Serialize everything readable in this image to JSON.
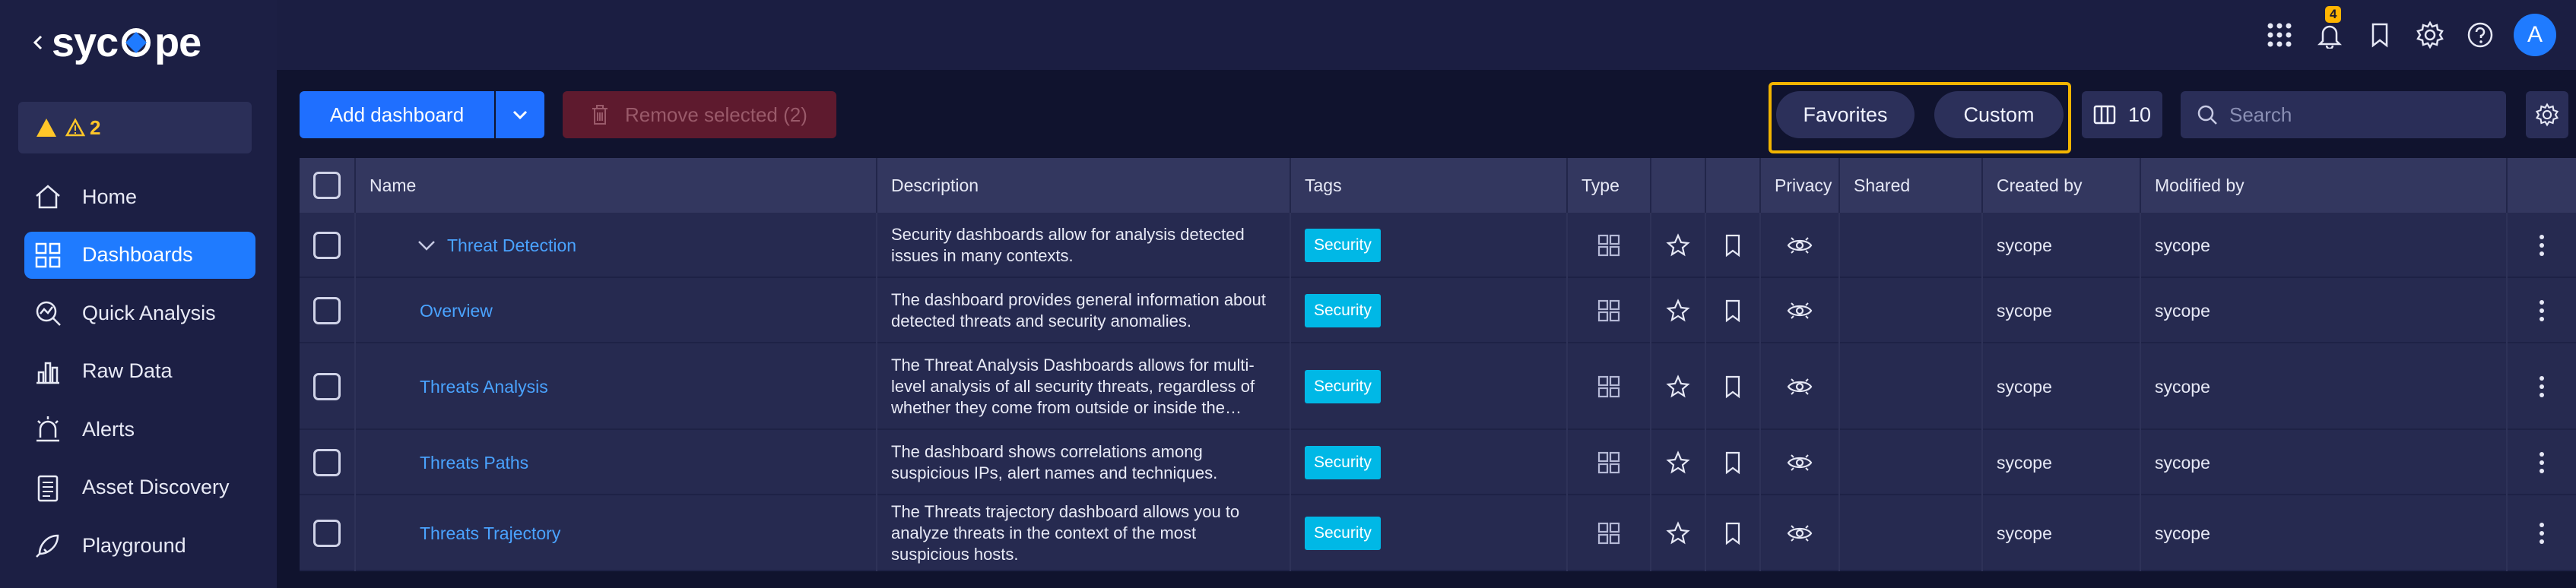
{
  "sidebar": {
    "logo": "sycope",
    "alert_count": "2",
    "items": [
      {
        "label": "Home",
        "icon": "home-icon",
        "active": false
      },
      {
        "label": "Dashboards",
        "icon": "dashboards-icon",
        "active": true
      },
      {
        "label": "Quick Analysis",
        "icon": "quick-analysis-icon",
        "active": false
      },
      {
        "label": "Raw Data",
        "icon": "raw-data-icon",
        "active": false
      },
      {
        "label": "Alerts",
        "icon": "alerts-icon",
        "active": false
      },
      {
        "label": "Asset Discovery",
        "icon": "asset-discovery-icon",
        "active": false
      },
      {
        "label": "Playground",
        "icon": "playground-icon",
        "active": false
      }
    ]
  },
  "topbar": {
    "notification_count": "4",
    "avatar_initial": "A"
  },
  "toolbar": {
    "add_label": "Add dashboard",
    "remove_label": "Remove selected (2)",
    "favorites_label": "Favorites",
    "custom_label": "Custom",
    "columns_count": "10",
    "search_placeholder": "Search"
  },
  "table": {
    "headers": [
      "Name",
      "Description",
      "Tags",
      "Type",
      "",
      "",
      "Privacy",
      "Shared",
      "Created by",
      "Modified by"
    ],
    "rows": [
      {
        "name": "Threat Detection",
        "expandable": true,
        "description": "Security dashboards allow for analysis detected issues in many contexts.",
        "tag": "Security",
        "created_by": "sycope",
        "modified_by": "sycope"
      },
      {
        "name": "Overview",
        "expandable": false,
        "description": "The dashboard provides general information about detected threats and security anomalies.",
        "tag": "Security",
        "created_by": "sycope",
        "modified_by": "sycope"
      },
      {
        "name": "Threats Analysis",
        "expandable": false,
        "description": "The Threat Analysis Dashboards allows for multi-level analysis of all security threats, regardless of whether they come from outside or inside the…",
        "tag": "Security",
        "created_by": "sycope",
        "modified_by": "sycope"
      },
      {
        "name": "Threats Paths",
        "expandable": false,
        "description": "The dashboard shows correlations among suspicious IPs, alert names and techniques.",
        "tag": "Security",
        "created_by": "sycope",
        "modified_by": "sycope"
      },
      {
        "name": "Threats Trajectory",
        "expandable": false,
        "description": "The Threats trajectory dashboard allows you to analyze threats in the context of the most suspicious hosts.",
        "tag": "Security",
        "created_by": "sycope",
        "modified_by": "sycope"
      }
    ]
  },
  "colors": {
    "accent": "#1f7bff",
    "highlight_border": "#f2b400",
    "tag": "#00b8e6",
    "link": "#4aa3ff"
  }
}
